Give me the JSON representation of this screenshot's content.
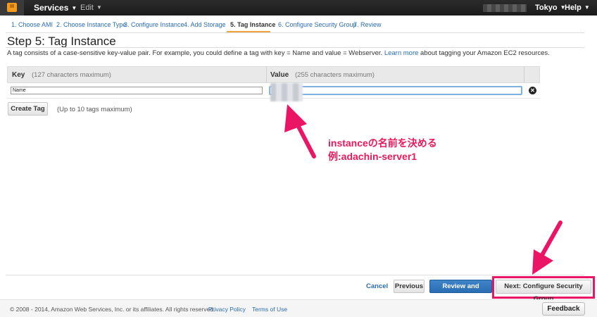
{
  "nav": {
    "services": "Services",
    "edit": "Edit",
    "region": "Tokyo",
    "help": "Help"
  },
  "tabs": [
    {
      "label": "1. Choose AMI"
    },
    {
      "label": "2. Choose Instance Type"
    },
    {
      "label": "3. Configure Instance"
    },
    {
      "label": "4. Add Storage"
    },
    {
      "label": "5. Tag Instance"
    },
    {
      "label": "6. Configure Security Group"
    },
    {
      "label": "7. Review"
    }
  ],
  "page": {
    "title": "Step 5: Tag Instance",
    "description": "A tag consists of a case-sensitive key-value pair. For example, you could define a tag with key = Name and value = Webserver.",
    "learn_more": "Learn more",
    "description_tail": "about tagging your Amazon EC2 resources."
  },
  "table": {
    "key_header": "Key",
    "key_hint": "(127 characters maximum)",
    "value_header": "Value",
    "value_hint": "(255 characters maximum)",
    "row": {
      "key": "Name",
      "value": ""
    }
  },
  "create_tag": {
    "label": "Create Tag",
    "hint": "(Up to 10 tags maximum)"
  },
  "annotation": {
    "line1": "instanceの名前を決める",
    "line2": "例:adachin-server1",
    "color": "#e8185a"
  },
  "footer_buttons": {
    "cancel": "Cancel",
    "previous": "Previous",
    "review": "Review and Launch",
    "next": "Next: Configure Security Group"
  },
  "page_footer": {
    "copyright": "© 2008 - 2014, Amazon Web Services, Inc. or its affiliates. All rights reserved.",
    "privacy": "Privacy Policy",
    "terms": "Terms of Use",
    "feedback": "Feedback"
  },
  "colors": {
    "link": "#2a6db3",
    "primary_button": "#2a6db3",
    "active_tab_underline": "#f0a23c",
    "highlight": "#ea1565"
  }
}
